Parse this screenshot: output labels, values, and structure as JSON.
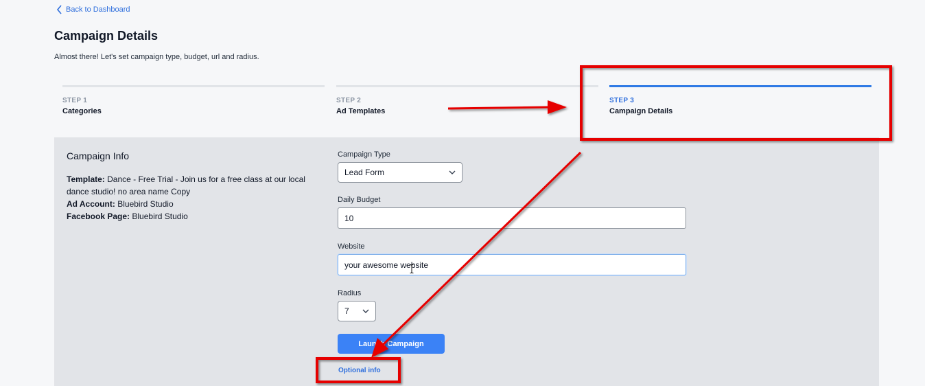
{
  "nav": {
    "back_label": "Back to Dashboard"
  },
  "header": {
    "title": "Campaign Details",
    "subtitle": "Almost there! Let's set campaign type, budget, url and radius."
  },
  "steps": [
    {
      "number": "STEP 1",
      "name": "Categories",
      "active": false
    },
    {
      "number": "STEP 2",
      "name": "Ad Templates",
      "active": false
    },
    {
      "number": "STEP 3",
      "name": "Campaign Details",
      "active": true
    }
  ],
  "campaign_info": {
    "title": "Campaign Info",
    "template_label": "Template:",
    "template_value": "Dance - Free Trial - Join us for a free class at our local dance studio! no area name Copy",
    "ad_account_label": "Ad Account:",
    "ad_account_value": "Bluebird Studio",
    "facebook_page_label": "Facebook Page:",
    "facebook_page_value": "Bluebird Studio"
  },
  "form": {
    "campaign_type": {
      "label": "Campaign Type",
      "value": "Lead Form"
    },
    "daily_budget": {
      "label": "Daily Budget",
      "value": "10"
    },
    "website": {
      "label": "Website",
      "value": "your awesome website"
    },
    "radius": {
      "label": "Radius",
      "value": "7"
    },
    "launch_label": "Launch Campaign",
    "optional_label": "Optional info"
  },
  "colors": {
    "accent": "#3b82f6",
    "link": "#2f6fdd",
    "annotation": "#e60000"
  },
  "icons": {
    "back": "chevron-left-icon",
    "select": "chevron-down-icon",
    "cursor": "text-cursor-icon"
  }
}
